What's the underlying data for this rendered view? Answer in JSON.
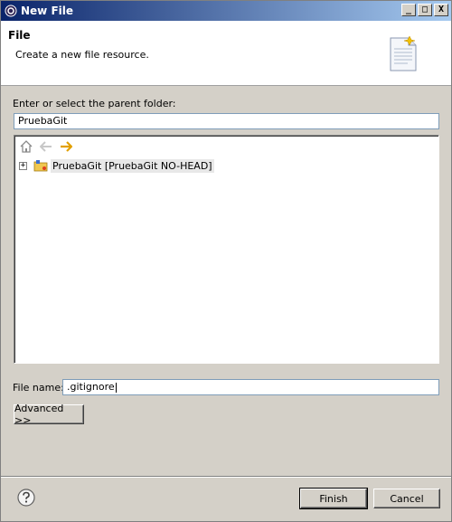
{
  "window": {
    "title": "New File",
    "controls": {
      "minimize": "_",
      "maximize": "□",
      "close": "X"
    }
  },
  "banner": {
    "title": "File",
    "message": "Create a new file resource.",
    "icon": "new-file-wizard-icon"
  },
  "parent_folder": {
    "label": "Enter or select the parent folder:",
    "value": "PruebaGit"
  },
  "tree": {
    "toolbar": [
      "home-icon",
      "back-arrow-icon",
      "forward-arrow-icon"
    ],
    "items": [
      {
        "label": "PruebaGit [PruebaGit NO-HEAD]",
        "expander": "+",
        "icon": "git-project-icon"
      }
    ]
  },
  "file_name": {
    "label": "File name:",
    "value": ".gitignore"
  },
  "buttons": {
    "advanced": "Advanced >>",
    "finish": "Finish",
    "cancel": "Cancel"
  },
  "colors": {
    "titlebar_start": "#0a246a",
    "titlebar_end": "#a6caf0",
    "dialog_bg": "#d4d0c8"
  }
}
